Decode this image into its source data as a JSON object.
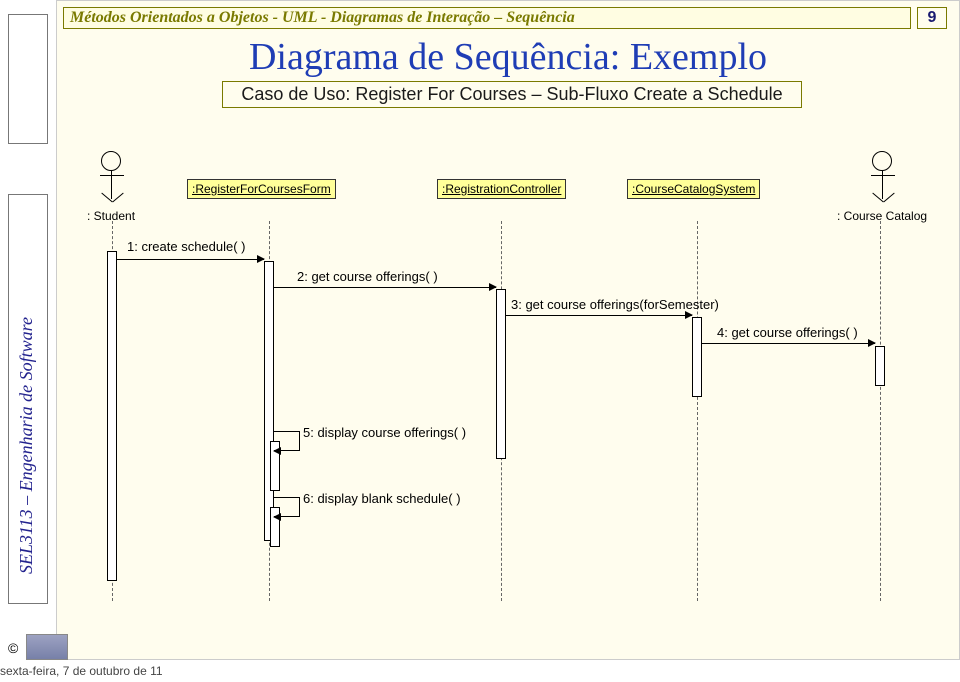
{
  "sidebar_label": "SEL3113 – Engenharia de Software",
  "header": "Métodos Orientados a Objetos - UML - Diagramas de Interação – Sequência",
  "page_number": "9",
  "title": "Diagrama de Sequência: Exemplo",
  "subtitle": "Caso de Uso: Register For Courses – Sub-Fluxo Create a Schedule",
  "actors": {
    "student": ": Student",
    "catalog": ": Course Catalog"
  },
  "objects": {
    "form": ":RegisterForCoursesForm",
    "controller": ":RegistrationController",
    "system": ":CourseCatalogSystem"
  },
  "messages": {
    "m1": "1: create schedule( )",
    "m2": "2: get course offerings( )",
    "m3": "3: get course offerings(forSemester)",
    "m4": "4: get course offerings( )",
    "m5": "5: display course offerings( )",
    "m6": "6: display blank schedule( )"
  },
  "footer": "sexta-feira, 7 de outubro de 11",
  "copyright": "©"
}
